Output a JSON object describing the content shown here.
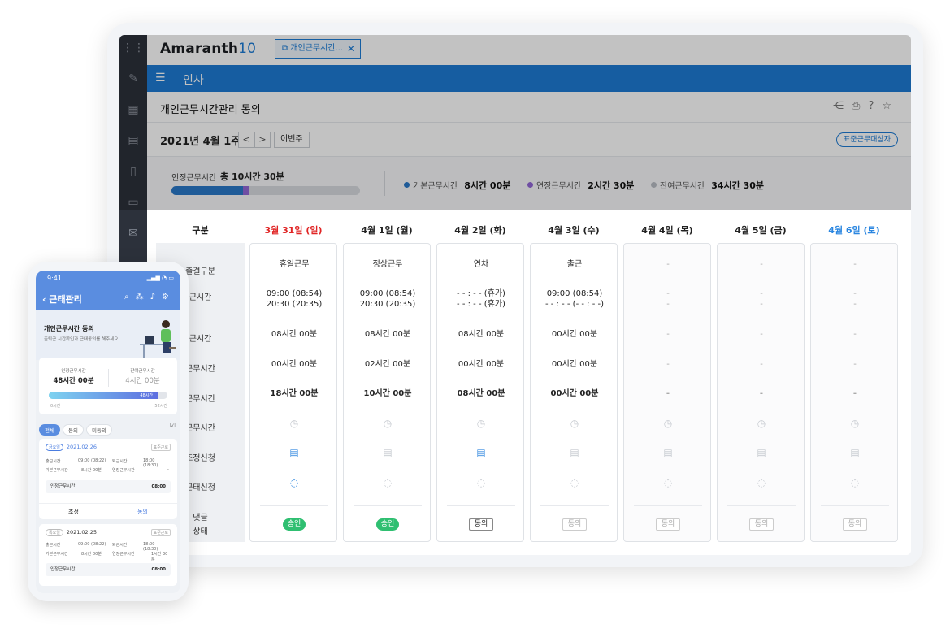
{
  "app": {
    "logo_main": "Amaranth",
    "logo_num": "10",
    "tab_label": "개인근무시간...",
    "menu_title": "인사",
    "page_title": "개인근무시간관리 동의",
    "week_label": "2021년 4월 1주",
    "prev": "<",
    "next": ">",
    "this_week": "이번주",
    "std_button": "표준근무대상자"
  },
  "summary": {
    "recognized_label": "인정근무시간",
    "recognized_total": "총 10시간 30분",
    "progress_base_fraction": 0.38,
    "progress_ext_fraction": 0.03,
    "legend": [
      {
        "label": "기본근무시간",
        "value": "8시간 00분",
        "color": "#2a78c8"
      },
      {
        "label": "연장근무시간",
        "value": "2시간 30분",
        "color": "#9367d6"
      },
      {
        "label": "잔여근무시간",
        "value": "34시간 30분",
        "color": "#b9bdc4"
      }
    ]
  },
  "grid": {
    "row_header": "구분",
    "rows": [
      "출결구분",
      "근시간",
      "근시간",
      "근무시간",
      "근무시간",
      "근무시간",
      "조정신청",
      "근태신청",
      "댓글",
      "상태"
    ],
    "days": [
      {
        "label": "3월 31일 (일)",
        "color": "#e02525",
        "type": "휴일근무",
        "in": "09:00 (08:54)",
        "out": "20:30 (20:35)",
        "basic": "08시간 00분",
        "ext": "00시간 00분",
        "total": "18시간 00분",
        "doc": true,
        "comment": true,
        "status": "승인",
        "status_kind": "ok",
        "dim": false
      },
      {
        "label": "4월 1일 (월)",
        "color": "#222222",
        "type": "정상근무",
        "in": "09:00 (08:54)",
        "out": "20:30 (20:35)",
        "basic": "08시간 00분",
        "ext": "02시간 00분",
        "total": "10시간 00분",
        "doc": false,
        "comment": false,
        "status": "승인",
        "status_kind": "ok",
        "dim": false
      },
      {
        "label": "4월 2일 (화)",
        "color": "#222222",
        "type": "연차",
        "in": "- - : - - (휴가)",
        "out": "- - : - - (휴가)",
        "basic": "08시간 00분",
        "ext": "00시간 00분",
        "total": "08시간 00분",
        "doc": true,
        "comment": false,
        "status": "동의",
        "status_kind": "agree",
        "dim": false
      },
      {
        "label": "4월 3일 (수)",
        "color": "#222222",
        "type": "출근",
        "in": "09:00 (08:54)",
        "out": "- - : - - (- - : - -)",
        "basic": "00시간 00분",
        "ext": "00시간 00분",
        "total": "00시간 00분",
        "doc": false,
        "comment": false,
        "status": "동의",
        "status_kind": "dis",
        "dim": false
      },
      {
        "label": "4월 4일 (목)",
        "color": "#222222",
        "type": "-",
        "in": "-",
        "out": "-",
        "basic": "-",
        "ext": "-",
        "total": "-",
        "doc": false,
        "comment": false,
        "status": "동의",
        "status_kind": "dis",
        "dim": true
      },
      {
        "label": "4월 5일 (금)",
        "color": "#222222",
        "type": "-",
        "in": "-",
        "out": "-",
        "basic": "-",
        "ext": "-",
        "total": "-",
        "doc": false,
        "comment": false,
        "status": "동의",
        "status_kind": "dis",
        "dim": true
      },
      {
        "label": "4월 6일 (토)",
        "color": "#2a86e0",
        "type": "-",
        "in": "-",
        "out": "-",
        "basic": "-",
        "ext": "-",
        "total": "-",
        "doc": false,
        "comment": false,
        "status": "동의",
        "status_kind": "dis",
        "dim": true
      }
    ]
  },
  "mobile": {
    "time": "9:41",
    "title": "근태관리",
    "banner_title": "개인근무시간 동의",
    "banner_sub": "출퇴근 시간확인과 근태동의를 해주세요.",
    "recognized_label": "인정근무시간",
    "recognized_value": "48시간 00분",
    "remain_label": "잔여근무시간",
    "remain_value": "4시간 00분",
    "bar_label": "48시간",
    "bar_fraction": 0.92,
    "bar_min": "0시간",
    "bar_max": "52시간",
    "tabs": [
      "전체",
      "동의",
      "미동의"
    ],
    "entries": [
      {
        "day": "금요일",
        "date": "2021.02.26",
        "tag": "표준근로",
        "in_l": "출근시간",
        "in_v": "09:00 (08:22)",
        "out_l": "퇴근시간",
        "out_v": "18:00 (18:30)",
        "base_l": "기본근무시간",
        "base_v": "8시간 00분",
        "ext_l": "연장근무시간",
        "ext_v": "-",
        "rec_l": "인정근무시간",
        "rec_v": "08:00",
        "left": "조정",
        "right": "동의"
      },
      {
        "day": "목요일",
        "date": "2021.02.25",
        "tag": "표준근로",
        "in_l": "출근시간",
        "in_v": "09:00 (08:22)",
        "out_l": "퇴근시간",
        "out_v": "18:00 (18:30)",
        "base_l": "기본근무시간",
        "base_v": "8시간 00분",
        "ext_l": "연장근무시간",
        "ext_v": "1시간 30분",
        "rec_l": "인정근무시간",
        "rec_v": "08:00"
      }
    ]
  }
}
